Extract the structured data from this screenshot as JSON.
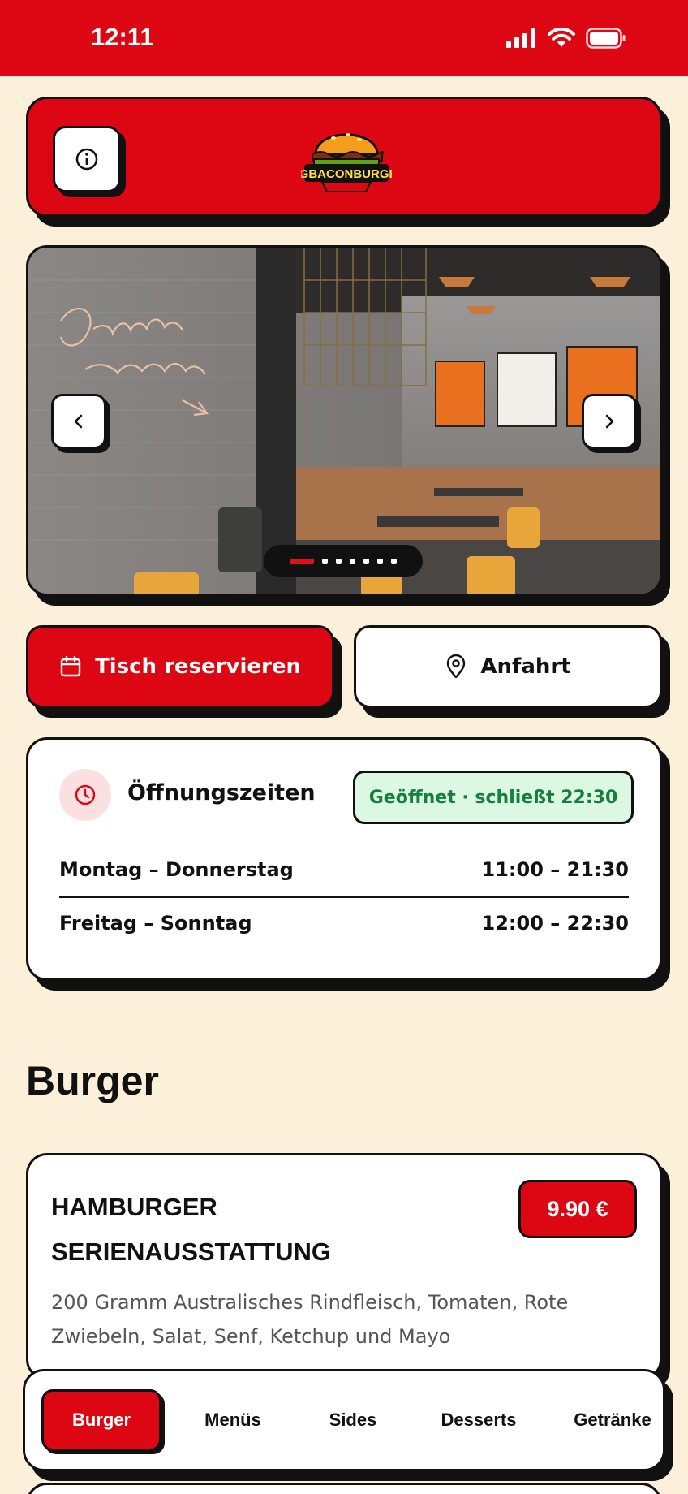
{
  "status_bar": {
    "time": "12:11"
  },
  "header": {
    "logo_text": "BIGBACONBURGER",
    "colors": {
      "brand_red": "#dd0713",
      "background": "#fcf0da"
    }
  },
  "gallery": {
    "slide_count": 7,
    "active_slide": 1,
    "neon_text": "Delights in the Making"
  },
  "actions": {
    "reserve_label": "Tisch reservieren",
    "route_label": "Anfahrt"
  },
  "hours": {
    "title": "Öffnungszeiten",
    "status": "Geöffnet · schließt 22:30",
    "rows": [
      {
        "days": "Montag – Donnerstag",
        "time": "11:00 – 21:30"
      },
      {
        "days": "Freitag – Sonntag",
        "time": "12:00 – 22:30"
      }
    ]
  },
  "section": {
    "title": "Burger"
  },
  "product": {
    "name": "HAMBURGER SERIENAUSSTATTUNG",
    "price": "9.90 €",
    "description": "200 Gramm Australisches Rindfleisch, Tomaten, Rote Zwiebeln, Salat, Senf, Ketchup und Mayo"
  },
  "tabs": [
    {
      "label": "Burger",
      "active": true
    },
    {
      "label": "Menüs"
    },
    {
      "label": "Sides"
    },
    {
      "label": "Desserts"
    },
    {
      "label": "Getränke"
    }
  ]
}
